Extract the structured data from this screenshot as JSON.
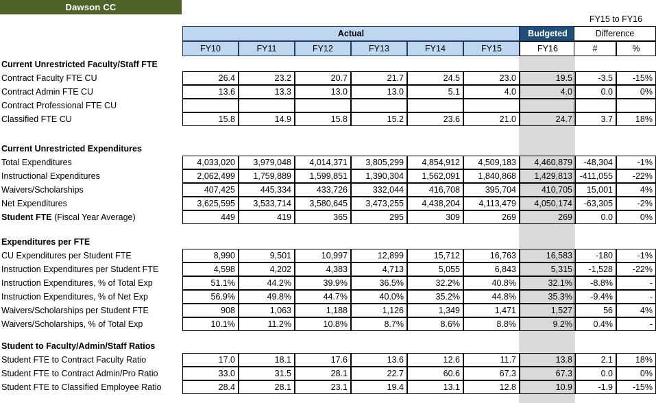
{
  "banner": {
    "title": "Dawson CC"
  },
  "header": {
    "difference_super": "FY15 to FY16",
    "actual_label": "Actual",
    "budgeted_label": "Budgeted",
    "difference_label": "Difference",
    "year_columns": [
      "FY10",
      "FY11",
      "FY12",
      "FY13",
      "FY14",
      "FY15",
      "FY16"
    ],
    "diff_columns": [
      "#",
      "%"
    ]
  },
  "colors": {
    "banner_green": "#4F6228",
    "header_blue": "#BDD7EE",
    "budgeted_navy": "#1F4E79",
    "highlight_gray": "#D9D9D9",
    "border": "#000000"
  },
  "sections": [
    {
      "title": "Current Unrestricted Faculty/Staff FTE",
      "rows": [
        {
          "label": "Contract Faculty FTE CU",
          "values": [
            "26.4",
            "23.2",
            "20.7",
            "21.7",
            "24.5",
            "23.0",
            "19.5"
          ],
          "diff_num": "-3.5",
          "diff_pct": "-15%"
        },
        {
          "label": "Contract Admin FTE CU",
          "values": [
            "13.6",
            "13.3",
            "13.0",
            "13.0",
            "5.1",
            "4.0",
            "4.0"
          ],
          "diff_num": "0.0",
          "diff_pct": "0%"
        },
        {
          "label": "Contract Professional FTE CU",
          "values": [
            "",
            "",
            "",
            "",
            "",
            "",
            ""
          ],
          "diff_num": "",
          "diff_pct": ""
        },
        {
          "label": "Classified FTE CU",
          "values": [
            "15.8",
            "14.9",
            "15.8",
            "15.2",
            "23.6",
            "21.0",
            "24.7"
          ],
          "diff_num": "3.7",
          "diff_pct": "18%"
        }
      ]
    },
    {
      "title": "Current Unrestricted Expenditures",
      "rows": [
        {
          "label": "Total Expenditures",
          "values": [
            "4,033,020",
            "3,979,048",
            "4,014,371",
            "3,805,299",
            "4,854,912",
            "4,509,183",
            "4,460,879"
          ],
          "diff_num": "-48,304",
          "diff_pct": "-1%"
        },
        {
          "label": "Instructional Expenditures",
          "values": [
            "2,062,499",
            "1,759,889",
            "1,599,851",
            "1,390,304",
            "1,562,091",
            "1,840,868",
            "1,429,813"
          ],
          "diff_num": "-411,055",
          "diff_pct": "-22%"
        },
        {
          "label": "Waivers/Scholarships",
          "values": [
            "407,425",
            "445,334",
            "433,726",
            "332,044",
            "416,708",
            "395,704",
            "410,705"
          ],
          "diff_num": "15,001",
          "diff_pct": "4%"
        },
        {
          "label": "Net Expenditures",
          "values": [
            "3,625,595",
            "3,533,714",
            "3,580,645",
            "3,473,255",
            "4,438,204",
            "4,113,479",
            "4,050,174"
          ],
          "diff_num": "-63,305",
          "diff_pct": "-2%"
        },
        {
          "label_bold": "Student FTE",
          "label_normal": " (Fiscal Year Average)",
          "values": [
            "449",
            "419",
            "365",
            "295",
            "309",
            "269",
            "269"
          ],
          "diff_num": "0.0",
          "diff_pct": "0%"
        }
      ]
    },
    {
      "title": "Expenditures per FTE",
      "rows": [
        {
          "label": "CU Expenditures per Student FTE",
          "values": [
            "8,990",
            "9,501",
            "10,997",
            "12,899",
            "15,712",
            "16,763",
            "16,583"
          ],
          "diff_num": "-180",
          "diff_pct": "-1%"
        },
        {
          "label": "Instruction Expenditures per Student FTE",
          "values": [
            "4,598",
            "4,202",
            "4,383",
            "4,713",
            "5,055",
            "6,843",
            "5,315"
          ],
          "diff_num": "-1,528",
          "diff_pct": "-22%"
        },
        {
          "label": "Instruction Expenditures, % of Total Exp",
          "values": [
            "51.1%",
            "44.2%",
            "39.9%",
            "36.5%",
            "32.2%",
            "40.8%",
            "32.1%"
          ],
          "diff_num": "-8.8%",
          "diff_pct": "-"
        },
        {
          "label": "Instruction Expenditures, % of Net Exp",
          "values": [
            "56.9%",
            "49.8%",
            "44.7%",
            "40.0%",
            "35.2%",
            "44.8%",
            "35.3%"
          ],
          "diff_num": "-9.4%",
          "diff_pct": "-"
        },
        {
          "label": "Waivers/Scholarships per Student FTE",
          "values": [
            "908",
            "1,063",
            "1,188",
            "1,126",
            "1,349",
            "1,471",
            "1,527"
          ],
          "diff_num": "56",
          "diff_pct": "4%"
        },
        {
          "label": "Waivers/Scholarships, % of Total Exp",
          "values": [
            "10.1%",
            "11.2%",
            "10.8%",
            "8.7%",
            "8.6%",
            "8.8%",
            "9.2%"
          ],
          "diff_num": "0.4%",
          "diff_pct": "-"
        }
      ]
    },
    {
      "title": "Student to Faculty/Admin/Staff Ratios",
      "rows": [
        {
          "label": "Student FTE to Contract Faculty Ratio",
          "values": [
            "17.0",
            "18.1",
            "17.6",
            "13.6",
            "12.6",
            "11.7",
            "13.8"
          ],
          "diff_num": "2.1",
          "diff_pct": "18%"
        },
        {
          "label": "Student FTE to Contract Admin/Pro Ratio",
          "values": [
            "33.0",
            "31.5",
            "28.1",
            "22.7",
            "60.6",
            "67.3",
            "67.3"
          ],
          "diff_num": "0.0",
          "diff_pct": "0%"
        },
        {
          "label": "Student FTE to Classified Employee Ratio",
          "values": [
            "28.4",
            "28.1",
            "23.1",
            "19.4",
            "13.1",
            "12.8",
            "10.9"
          ],
          "diff_num": "-1.9",
          "diff_pct": "-15%"
        }
      ]
    }
  ]
}
